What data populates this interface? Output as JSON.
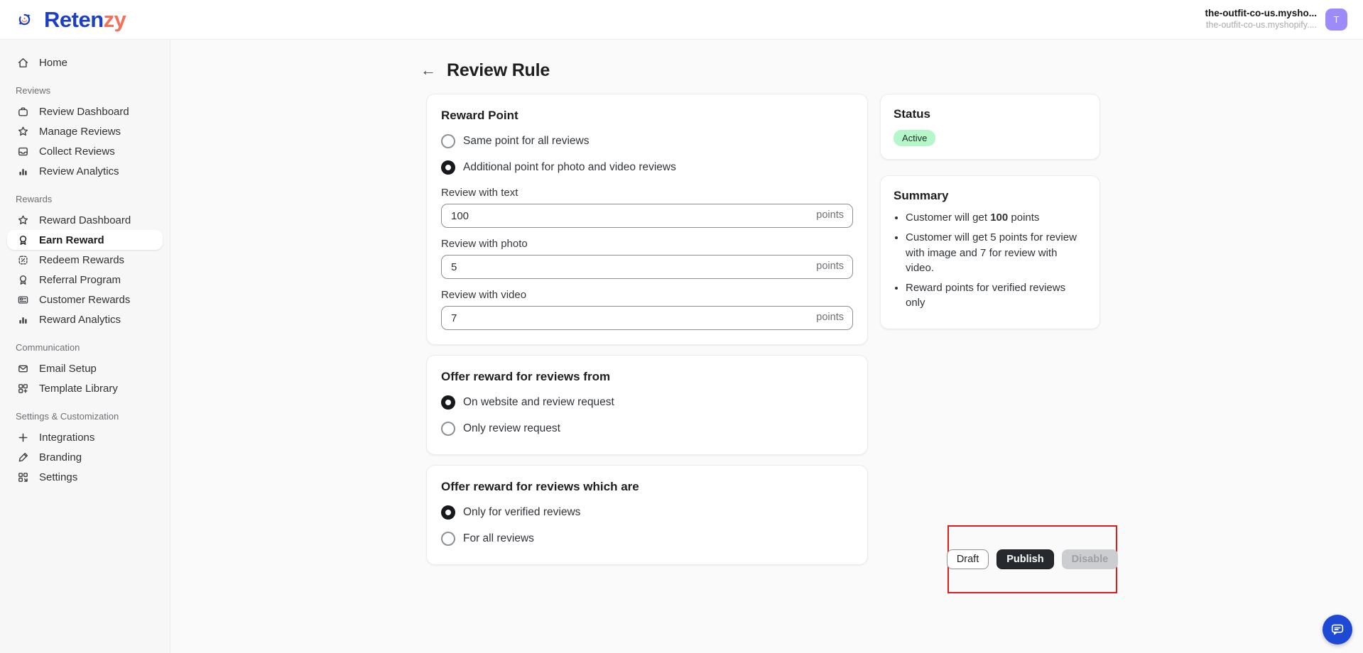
{
  "header": {
    "brand": {
      "name_primary": "Reten",
      "name_secondary": "zy"
    },
    "store": {
      "name": "the-outfit-co-us.mysho...",
      "domain": "the-outfit-co-us.myshopify....",
      "avatar_initial": "T"
    }
  },
  "sidebar": {
    "sections": [
      {
        "label": "",
        "items": [
          {
            "label": "Home",
            "icon": "home-icon",
            "active": false
          }
        ]
      },
      {
        "label": "Reviews",
        "items": [
          {
            "label": "Review Dashboard",
            "icon": "briefcase-icon",
            "active": false
          },
          {
            "label": "Manage Reviews",
            "icon": "star-icon",
            "active": false
          },
          {
            "label": "Collect Reviews",
            "icon": "inbox-icon",
            "active": false
          },
          {
            "label": "Review Analytics",
            "icon": "bar-chart-icon",
            "active": false
          }
        ]
      },
      {
        "label": "Rewards",
        "items": [
          {
            "label": "Reward Dashboard",
            "icon": "star-icon",
            "active": false
          },
          {
            "label": "Earn Reward",
            "icon": "medal-icon",
            "active": true
          },
          {
            "label": "Redeem Rewards",
            "icon": "discount-icon",
            "active": false
          },
          {
            "label": "Referral Program",
            "icon": "medal-icon",
            "active": false
          },
          {
            "label": "Customer Rewards",
            "icon": "giftcard-icon",
            "active": false
          },
          {
            "label": "Reward Analytics",
            "icon": "bar-chart-icon",
            "active": false
          }
        ]
      },
      {
        "label": "Communication",
        "items": [
          {
            "label": "Email Setup",
            "icon": "envelope-icon",
            "active": false
          },
          {
            "label": "Template Library",
            "icon": "template-icon",
            "active": false
          }
        ]
      },
      {
        "label": "Settings & Customization",
        "items": [
          {
            "label": "Integrations",
            "icon": "plus-icon",
            "active": false
          },
          {
            "label": "Branding",
            "icon": "brush-icon",
            "active": false
          },
          {
            "label": "Settings",
            "icon": "settings-grid-icon",
            "active": false
          }
        ]
      }
    ]
  },
  "page": {
    "title": "Review Rule"
  },
  "reward_point_card": {
    "title": "Reward Point",
    "options": [
      {
        "label": "Same point for all reviews",
        "selected": false
      },
      {
        "label": "Additional point for photo and video reviews",
        "selected": true
      }
    ],
    "fields": [
      {
        "label": "Review with text",
        "value": "100",
        "suffix": "points"
      },
      {
        "label": "Review with photo",
        "value": "5",
        "suffix": "points"
      },
      {
        "label": "Review with video",
        "value": "7",
        "suffix": "points"
      }
    ]
  },
  "reviews_from_card": {
    "title": "Offer reward for reviews from",
    "options": [
      {
        "label": "On website and review request",
        "selected": true
      },
      {
        "label": "Only review request",
        "selected": false
      }
    ]
  },
  "reviews_which_card": {
    "title": "Offer reward for reviews which are",
    "options": [
      {
        "label": "Only for verified reviews",
        "selected": true
      },
      {
        "label": "For all reviews",
        "selected": false
      }
    ]
  },
  "status_card": {
    "title": "Status",
    "badge": "Active"
  },
  "summary_card": {
    "title": "Summary",
    "bullet1": {
      "prefix": "Customer will get ",
      "bold": "100",
      "suffix": " points"
    },
    "bullet2": "Customer will get 5 points for review with image and 7 for review with video.",
    "bullet3": "Reward points for verified reviews only"
  },
  "actions": {
    "draft": "Draft",
    "publish": "Publish",
    "disable": "Disable"
  },
  "colors": {
    "brand_blue": "#1d3fc4",
    "brand_coral": "#f4705a",
    "badge_green_bg": "#b5f7c8",
    "highlight_red": "#df1b1b",
    "publish_dark": "#26292d",
    "chat_blue": "#1d49d5",
    "avatar_purple": "#9c8bf8"
  }
}
